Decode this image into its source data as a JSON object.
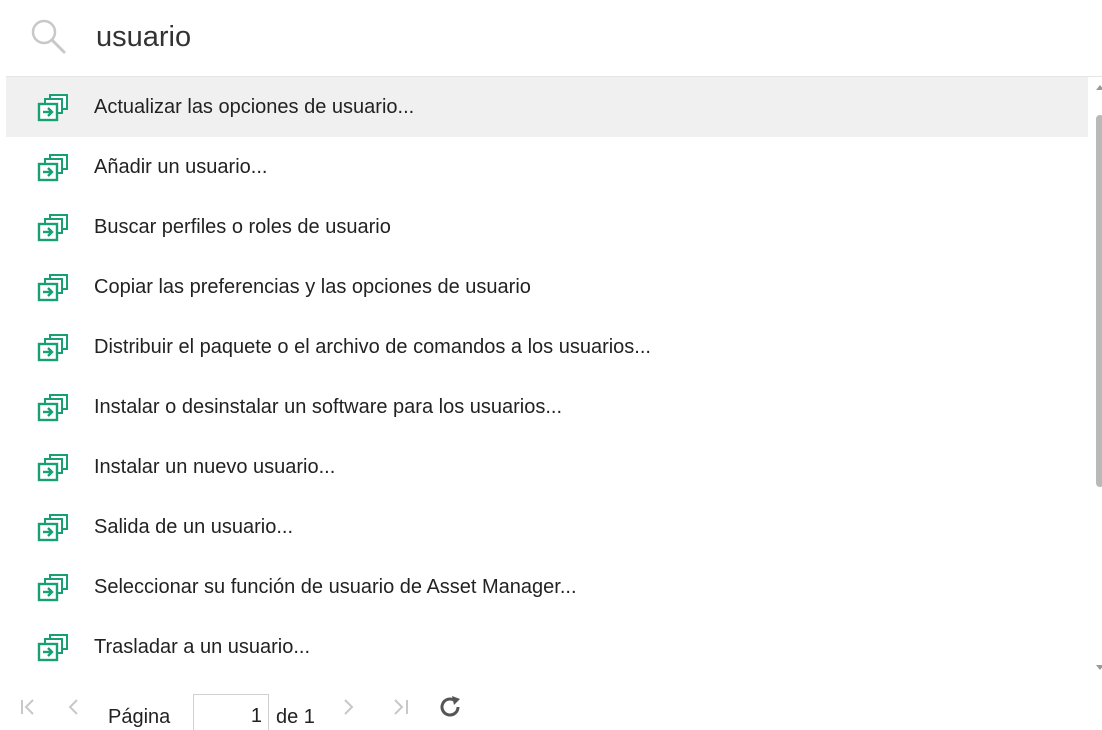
{
  "search": {
    "query": "usuario"
  },
  "results": [
    {
      "label": "Actualizar las opciones de usuario...",
      "icon": "wizard-icon",
      "selected": true
    },
    {
      "label": "Añadir un usuario...",
      "icon": "wizard-icon"
    },
    {
      "label": "Buscar perfiles o roles de usuario",
      "icon": "wizard-icon"
    },
    {
      "label": "Copiar las preferencias y las opciones de usuario",
      "icon": "wizard-icon"
    },
    {
      "label": "Distribuir el paquete o el archivo de comandos a los usuarios...",
      "icon": "wizard-icon"
    },
    {
      "label": "Instalar o desinstalar un software para los usuarios...",
      "icon": "wizard-icon"
    },
    {
      "label": "Instalar un nuevo usuario...",
      "icon": "wizard-icon"
    },
    {
      "label": "Salida de un usuario...",
      "icon": "wizard-icon"
    },
    {
      "label": "Seleccionar su función de usuario de Asset Manager...",
      "icon": "wizard-icon"
    },
    {
      "label": "Trasladar a un usuario...",
      "icon": "wizard-icon"
    }
  ],
  "pager": {
    "page_label": "Página",
    "current_page": "1",
    "of_label": "de 1"
  },
  "colors": {
    "icon_green": "#1a9e74",
    "selected_row": "#f0f0f0",
    "disabled_control": "#c8c8c8"
  }
}
